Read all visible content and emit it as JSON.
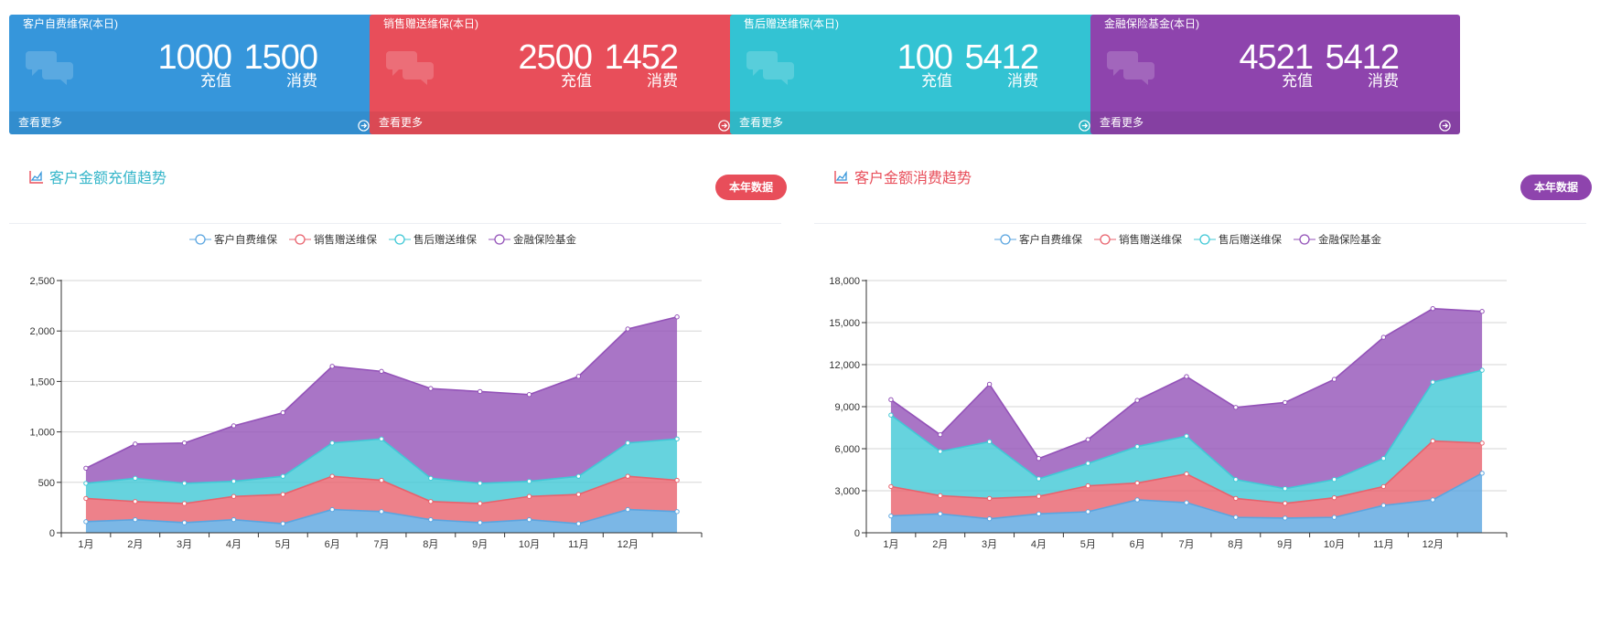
{
  "cards": [
    {
      "title": "客户自费维保(本日)",
      "recharge_value": "1000",
      "recharge_label": "充值",
      "consume_value": "1500",
      "consume_label": "消费",
      "more": "查看更多",
      "color": "#3696db"
    },
    {
      "title": "销售赠送维保(本日)",
      "recharge_value": "2500",
      "recharge_label": "充值",
      "consume_value": "1452",
      "consume_label": "消费",
      "more": "查看更多",
      "color": "#e84e5a"
    },
    {
      "title": "售后赠送维保(本日)",
      "recharge_value": "100",
      "recharge_label": "充值",
      "consume_value": "5412",
      "consume_label": "消费",
      "more": "查看更多",
      "color": "#33c3d3"
    },
    {
      "title": "金融保险基金(本日)",
      "recharge_value": "4521",
      "recharge_label": "充值",
      "consume_value": "5412",
      "consume_label": "消费",
      "more": "查看更多",
      "color": "#8e44ad"
    }
  ],
  "panels": [
    {
      "title": "客户金额充值趋势",
      "title_color": "#33b5c9",
      "button": "本年数据",
      "button_color": "#e84e5a",
      "icon": "area-chart-icon"
    },
    {
      "title": "客户金额消费趋势",
      "title_color": "#e84e5a",
      "button": "本年数据",
      "button_color": "#8e44ad",
      "icon": "area-chart-icon"
    }
  ],
  "chart_data": [
    {
      "type": "area",
      "stacked": true,
      "title": "客户金额充值趋势",
      "categories": [
        "1月",
        "2月",
        "3月",
        "4月",
        "5月",
        "6月",
        "7月",
        "8月",
        "9月",
        "10月",
        "11月",
        "12月",
        ""
      ],
      "ylim": [
        0,
        2500
      ],
      "yticks": [
        0,
        500,
        1000,
        1500,
        2000,
        2500
      ],
      "ytick_labels": [
        "0",
        "500",
        "1,000",
        "1,500",
        "2,000",
        "2,500"
      ],
      "grid": true,
      "legend_position": "top-center",
      "series": [
        {
          "name": "客户自费维保",
          "color": "#5aa5e0",
          "values": [
            110,
            130,
            100,
            130,
            90,
            230,
            210,
            130,
            100,
            130,
            90,
            230,
            210
          ]
        },
        {
          "name": "销售赠送维保",
          "color": "#e8626d",
          "values": [
            230,
            180,
            190,
            230,
            290,
            330,
            310,
            180,
            190,
            230,
            290,
            330,
            310
          ]
        },
        {
          "name": "售后赠送维保",
          "color": "#40c8d6",
          "values": [
            150,
            230,
            200,
            150,
            180,
            330,
            410,
            230,
            200,
            150,
            180,
            330,
            410
          ]
        },
        {
          "name": "金融保险基金",
          "color": "#9352b8",
          "values": [
            150,
            340,
            400,
            550,
            630,
            760,
            670,
            890,
            910,
            860,
            990,
            1130,
            1210
          ]
        }
      ]
    },
    {
      "type": "area",
      "stacked": true,
      "title": "客户金额消费趋势",
      "categories": [
        "1月",
        "2月",
        "3月",
        "4月",
        "5月",
        "6月",
        "7月",
        "8月",
        "9月",
        "10月",
        "11月",
        "12月",
        ""
      ],
      "ylim": [
        0,
        18000
      ],
      "yticks": [
        0,
        3000,
        6000,
        9000,
        12000,
        15000,
        18000
      ],
      "ytick_labels": [
        "0",
        "3,000",
        "6,000",
        "9,000",
        "12,000",
        "15,000",
        "18,000"
      ],
      "grid": true,
      "legend_position": "top-center",
      "series": [
        {
          "name": "客户自费维保",
          "color": "#5aa5e0",
          "values": [
            1200,
            1350,
            1000,
            1350,
            1500,
            2350,
            2150,
            1100,
            1050,
            1100,
            1950,
            2350,
            4250
          ]
        },
        {
          "name": "销售赠送维保",
          "color": "#e8626d",
          "values": [
            2100,
            1300,
            1450,
            1250,
            1850,
            1200,
            2050,
            1350,
            1050,
            1400,
            1350,
            4200,
            2150
          ]
        },
        {
          "name": "售后赠送维保",
          "color": "#40c8d6",
          "values": [
            5100,
            3150,
            4050,
            1250,
            1600,
            2600,
            2700,
            1350,
            1050,
            1300,
            2000,
            4200,
            5200
          ]
        },
        {
          "name": "金融保险基金",
          "color": "#9352b8",
          "values": [
            1100,
            1200,
            4100,
            1450,
            1700,
            3300,
            4250,
            5150,
            6150,
            7150,
            8650,
            5250,
            4200
          ]
        }
      ]
    }
  ]
}
